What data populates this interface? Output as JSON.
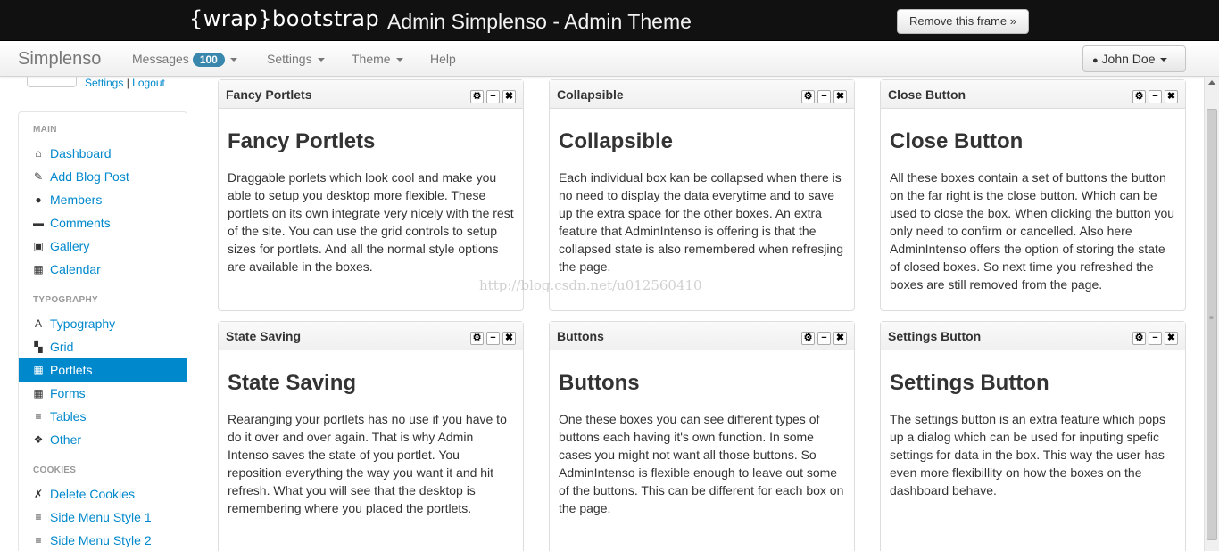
{
  "frame": {
    "logo": "{wrap}bootstrap",
    "title": "Admin Simplenso - Admin Theme",
    "remove_button": "Remove this frame »"
  },
  "navbar": {
    "brand": "Simplenso",
    "messages_label": "Messages",
    "messages_count": "100",
    "settings_label": "Settings",
    "theme_label": "Theme",
    "help_label": "Help",
    "user_label": "John Doe"
  },
  "profile": {
    "settings_link": "Settings",
    "separator": "|",
    "logout_link": "Logout"
  },
  "sidebar": {
    "sections": [
      {
        "header": "MAIN",
        "items": [
          {
            "label": "Dashboard",
            "icon": "home-icon",
            "glyph": "⌂"
          },
          {
            "label": "Add Blog Post",
            "icon": "edit-icon",
            "glyph": "✎"
          },
          {
            "label": "Members",
            "icon": "user-icon",
            "glyph": "●"
          },
          {
            "label": "Comments",
            "icon": "comment-icon",
            "glyph": "▬"
          },
          {
            "label": "Gallery",
            "icon": "picture-icon",
            "glyph": "▣"
          },
          {
            "label": "Calendar",
            "icon": "calendar-icon",
            "glyph": "▦"
          }
        ]
      },
      {
        "header": "TYPOGRAPHY",
        "items": [
          {
            "label": "Typography",
            "icon": "font-icon",
            "glyph": "A"
          },
          {
            "label": "Grid",
            "icon": "grid-icon",
            "glyph": "▚"
          },
          {
            "label": "Portlets",
            "icon": "th-icon",
            "glyph": "▦",
            "active": true
          },
          {
            "label": "Forms",
            "icon": "th-icon",
            "glyph": "▦"
          },
          {
            "label": "Tables",
            "icon": "list-icon",
            "glyph": "≡"
          },
          {
            "label": "Other",
            "icon": "gift-icon",
            "glyph": "❖"
          }
        ]
      },
      {
        "header": "COOKIES",
        "items": [
          {
            "label": "Delete Cookies",
            "icon": "wrench-icon",
            "glyph": "✗"
          },
          {
            "label": "Side Menu Style 1",
            "icon": "align-left-icon",
            "glyph": "≡"
          },
          {
            "label": "Side Menu Style 2",
            "icon": "align-right-icon",
            "glyph": "≡"
          }
        ]
      }
    ]
  },
  "portlets": [
    {
      "title": "Fancy Portlets",
      "heading": "Fancy Portlets",
      "text": "Draggable porlets which look cool and make you able to setup you desktop more flexible. These portlets on its own integrate very nicely with the rest of the site. You can use the grid controls to setup sizes for portlets. And all the normal style options are available in the boxes."
    },
    {
      "title": "Collapsible",
      "heading": "Collapsible",
      "text": "Each individual box kan be collapsed when there is no need to display the data everytime and to save up the extra space for the other boxes. An extra feature that AdminIntenso is offering is that the collapsed state is also remembered when refresjing the page."
    },
    {
      "title": "Close Button",
      "heading": "Close Button",
      "text": "All these boxes contain a set of buttons the button on the far right is the close button. Which can be used to close the box. When clicking the button you only need to confirm or cancelled. Also here AdminIntenso offers the option of storing the state of closed boxes. So next time you refreshed the boxes are still removed from the page."
    },
    {
      "title": "State Saving",
      "heading": "State Saving",
      "text": "Rearanging your portlets has no use if you have to do it over and over again. That is why Admin Intenso saves the state of you portlet. You reposition everything the way you want it and hit refresh. What you will see that the desktop is remembering where you placed the portlets."
    },
    {
      "title": "Buttons",
      "heading": "Buttons",
      "text": "One these boxes you can see different types of buttons each having it's own function. In some cases you might not want all those buttons. So AdminIntenso is flexible enough to leave out some of the buttons. This can be different for each box on the page."
    },
    {
      "title": "Settings Button",
      "heading": "Settings Button",
      "text": "The settings button is an extra feature which pops up a dialog which can be used for inputing spefic settings for data in the box. This way the user has even more flexibillity on how the boxes on the dashboard behave."
    }
  ],
  "portlet_buttons": {
    "settings": "⚙",
    "minimize": "−",
    "close": "✖"
  },
  "watermark": "http://blog.csdn.net/u012560410",
  "colors": {
    "accent": "#0088cc",
    "badge": "#3a87ad",
    "frame_bg": "#111111"
  }
}
